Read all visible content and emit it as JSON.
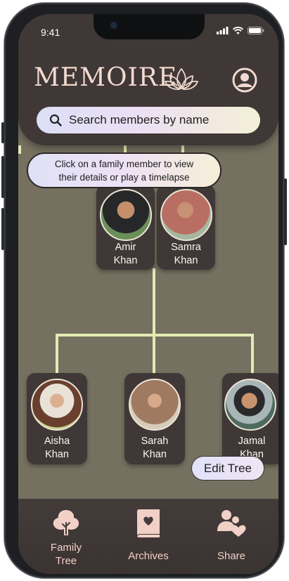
{
  "status_bar": {
    "time": "9:41"
  },
  "header": {
    "app_name": "MEMOIRE",
    "search_placeholder": "Search members by name"
  },
  "tooltip": {
    "line1": "Click on a family member to view",
    "line2": "their details or play a timelapse"
  },
  "tree": {
    "parents": [
      {
        "first": "Amir",
        "last": "Khan"
      },
      {
        "first": "Samra",
        "last": "Khan"
      }
    ],
    "children": [
      {
        "first": "Aisha",
        "last": "Khan"
      },
      {
        "first": "Sarah",
        "last": "Khan"
      },
      {
        "first": "Jamal",
        "last": "Khan"
      }
    ]
  },
  "edit_button": "Edit Tree",
  "tabs": [
    {
      "line1": "Family",
      "line2": "Tree",
      "icon": "tree-icon"
    },
    {
      "label": "Archives",
      "icon": "book-icon"
    },
    {
      "label": "Share",
      "icon": "share-people-icon"
    }
  ],
  "colors": {
    "background": "#75705f",
    "panel": "#3f3836",
    "accent": "#f2d0c8",
    "tree_line": "#e3ebb4"
  }
}
